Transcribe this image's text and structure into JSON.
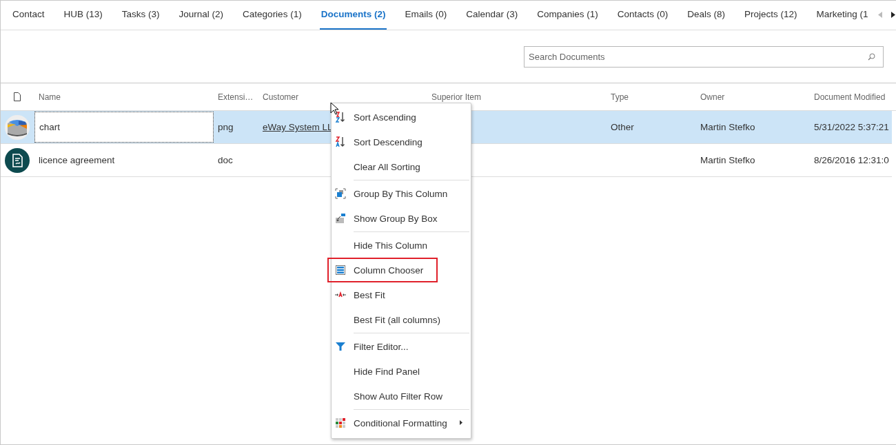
{
  "tabs": [
    {
      "label": "Contact",
      "selected": false
    },
    {
      "label": "HUB (13)",
      "selected": false
    },
    {
      "label": "Tasks (3)",
      "selected": false
    },
    {
      "label": "Journal (2)",
      "selected": false
    },
    {
      "label": "Categories (1)",
      "selected": false
    },
    {
      "label": "Documents (2)",
      "selected": true
    },
    {
      "label": "Emails (0)",
      "selected": false
    },
    {
      "label": "Calendar (3)",
      "selected": false
    },
    {
      "label": "Companies (1)",
      "selected": false
    },
    {
      "label": "Contacts (0)",
      "selected": false
    },
    {
      "label": "Deals (8)",
      "selected": false
    },
    {
      "label": "Projects (12)",
      "selected": false
    },
    {
      "label": "Marketing (1",
      "selected": false
    }
  ],
  "search": {
    "placeholder": "Search Documents"
  },
  "table": {
    "columns": [
      "Name",
      "Extensi…",
      "Customer",
      "Superior Item",
      "Type",
      "Owner",
      "Document Modified"
    ],
    "rows": [
      {
        "kind": "image",
        "selected": true,
        "name": "chart",
        "extension": "png",
        "customer": "eWay System LL",
        "type": "Other",
        "owner": "Martin Stefko",
        "modified": "5/31/2022 5:37:21"
      },
      {
        "kind": "doc",
        "selected": false,
        "name": "licence agreement",
        "extension": "doc",
        "owner": "Martin Stefko",
        "modified": "8/26/2016 12:31:0"
      }
    ]
  },
  "context_menu": {
    "groups": [
      {
        "items": [
          {
            "label": "Sort Ascending",
            "kind": "sort-asc",
            "highlighted": false,
            "submenu": false
          },
          {
            "label": "Sort Descending",
            "kind": "sort-desc",
            "highlighted": false,
            "submenu": false
          },
          {
            "label": "Clear All Sorting",
            "kind": "plain",
            "highlighted": false,
            "submenu": false
          }
        ]
      },
      {
        "items": [
          {
            "label": "Group By This Column",
            "kind": "group",
            "highlighted": false,
            "submenu": false
          },
          {
            "label": "Show Group By Box",
            "kind": "groupbox",
            "highlighted": false,
            "submenu": false
          }
        ]
      },
      {
        "items": [
          {
            "label": "Hide This Column",
            "kind": "plain",
            "highlighted": false,
            "submenu": false
          },
          {
            "label": "Column Chooser",
            "kind": "columns",
            "highlighted": true,
            "submenu": false
          },
          {
            "label": "Best Fit",
            "kind": "bestfit",
            "highlighted": false,
            "submenu": false
          },
          {
            "label": "Best Fit (all columns)",
            "kind": "plain",
            "highlighted": false,
            "submenu": false
          }
        ]
      },
      {
        "items": [
          {
            "label": "Filter Editor...",
            "kind": "filter",
            "highlighted": false,
            "submenu": false
          },
          {
            "label": "Hide Find Panel",
            "kind": "plain",
            "highlighted": false,
            "submenu": false
          },
          {
            "label": "Show Auto Filter Row",
            "kind": "plain",
            "highlighted": false,
            "submenu": false
          }
        ]
      },
      {
        "items": [
          {
            "label": "Conditional Formatting",
            "kind": "condfmt",
            "highlighted": false,
            "submenu": true
          }
        ]
      }
    ]
  }
}
